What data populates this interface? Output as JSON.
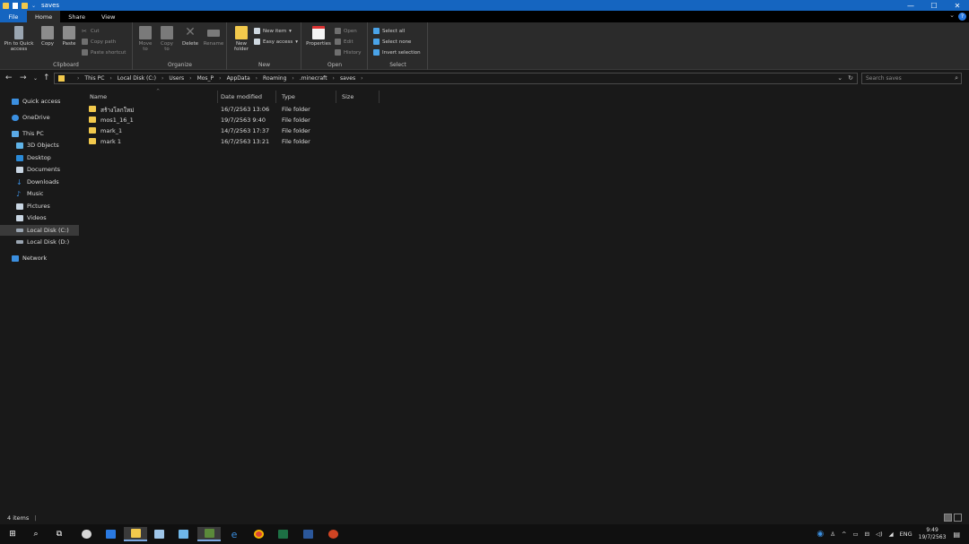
{
  "window": {
    "title": "saves",
    "controls": {
      "minimize": "—",
      "maximize": "☐",
      "close": "✕"
    }
  },
  "ribbon_tabs": [
    "File",
    "Home",
    "Share",
    "View"
  ],
  "ribbon": {
    "clipboard": {
      "label": "Clipboard",
      "pin": "Pin to Quick access",
      "copy": "Copy",
      "paste": "Paste",
      "cut": "Cut",
      "copy_path": "Copy path",
      "paste_shortcut": "Paste shortcut"
    },
    "organize": {
      "label": "Organize",
      "move_to": "Move to",
      "copy_to": "Copy to",
      "delete": "Delete",
      "rename": "Rename"
    },
    "new": {
      "label": "New",
      "new_folder": "New folder",
      "new_item": "New item",
      "easy_access": "Easy access"
    },
    "open": {
      "label": "Open",
      "properties": "Properties",
      "open": "Open",
      "edit": "Edit",
      "history": "History"
    },
    "select": {
      "label": "Select",
      "select_all": "Select all",
      "select_none": "Select none",
      "invert_selection": "Invert selection"
    }
  },
  "address": {
    "breadcrumbs": [
      "This PC",
      "Local Disk (C:)",
      "Users",
      "Mos_P",
      "AppData",
      "Roaming",
      ".minecraft",
      "saves"
    ],
    "search_placeholder": "Search saves"
  },
  "nav_pane": [
    {
      "label": "Quick access",
      "icon": "star-icon",
      "color": "#3b8fe0"
    },
    {
      "label": "OneDrive",
      "icon": "cloud-icon",
      "color": "#3b8fe0"
    },
    {
      "label": "This PC",
      "icon": "computer-icon",
      "color": "#5aa9e6"
    },
    {
      "label": "3D Objects",
      "icon": "cube-icon",
      "color": "#5fb3e8"
    },
    {
      "label": "Desktop",
      "icon": "desktop-icon",
      "color": "#2a8ad8"
    },
    {
      "label": "Documents",
      "icon": "documents-icon",
      "color": "#c9d6e3"
    },
    {
      "label": "Downloads",
      "icon": "download-icon",
      "color": "#3b8fe0"
    },
    {
      "label": "Music",
      "icon": "music-icon",
      "color": "#3b8fe0"
    },
    {
      "label": "Pictures",
      "icon": "pictures-icon",
      "color": "#c9d6e3"
    },
    {
      "label": "Videos",
      "icon": "videos-icon",
      "color": "#c9d6e3"
    },
    {
      "label": "Local Disk (C:)",
      "icon": "drive-icon",
      "color": "#9aa5b1"
    },
    {
      "label": "Local Disk (D:)",
      "icon": "drive-icon",
      "color": "#9aa5b1"
    },
    {
      "label": "Network",
      "icon": "network-icon",
      "color": "#3b8fe0"
    }
  ],
  "columns": [
    "Name",
    "Date modified",
    "Type",
    "Size"
  ],
  "files": [
    {
      "name": "สร้างโลกใหม่",
      "date": "16/7/2563 13:06",
      "type": "File folder",
      "size": ""
    },
    {
      "name": "mos1_16_1",
      "date": "19/7/2563 9:40",
      "type": "File folder",
      "size": ""
    },
    {
      "name": "mark_1",
      "date": "14/7/2563 17:37",
      "type": "File folder",
      "size": ""
    },
    {
      "name": "mark 1",
      "date": "16/7/2563 13:21",
      "type": "File folder",
      "size": ""
    }
  ],
  "status": {
    "items": "4 items"
  },
  "taskbar": {
    "language": "ENG",
    "time": "9:49",
    "date": "19/7/2563"
  }
}
